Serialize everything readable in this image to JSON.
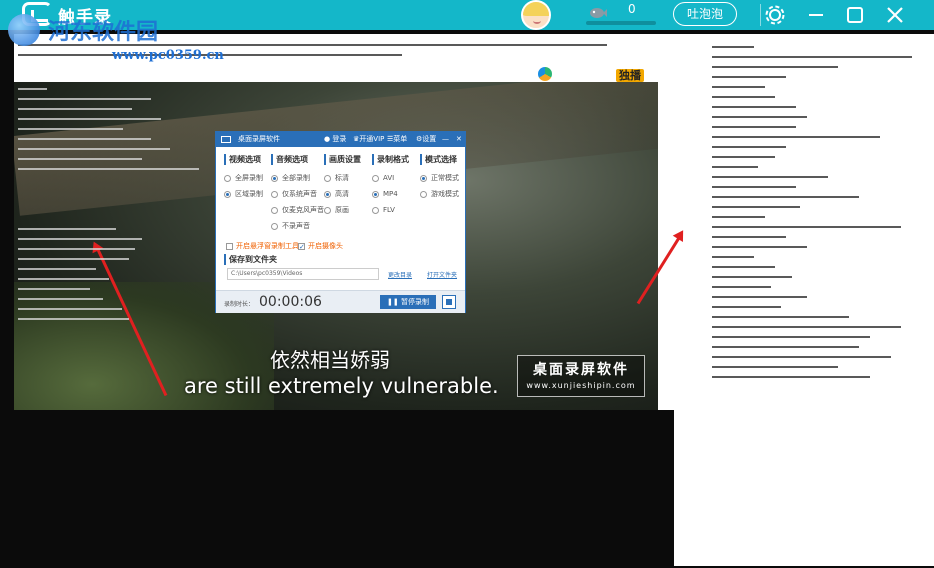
{
  "titlebar": {
    "app_name": "触手录",
    "coin_count": "0",
    "chat_button": "吐泡泡",
    "accent": "#14b7c9"
  },
  "watermark": {
    "site_name": "河东软件园",
    "site_url": "www.pc0359.cn"
  },
  "video": {
    "platform_logo": "腾讯视频",
    "platform_badge": "独播",
    "subtitle_cn": "依然相当娇弱",
    "subtitle_en": "are still extremely vulnerable.",
    "brand_cn": "桌面录屏软件",
    "brand_url": "www.xunjieshipin.com"
  },
  "dialog": {
    "title": "桌面录屏软件",
    "login": "登录",
    "vip": "开通VIP",
    "menu": "菜单",
    "settings": "设置",
    "video_options": {
      "header": "视频选项",
      "options": [
        "全屏录制",
        "区域录制"
      ]
    },
    "audio_options": {
      "header": "音频选项",
      "options": [
        "全部录制",
        "仅系统声音",
        "仅麦克风声音",
        "不录声音"
      ]
    },
    "quality": {
      "header": "画质设置",
      "options": [
        "标清",
        "高清",
        "原画"
      ]
    },
    "format": {
      "header": "录制格式",
      "options": [
        "AVI",
        "MP4",
        "FLV"
      ]
    },
    "mode": {
      "header": "模式选择",
      "options": [
        "正常模式",
        "游戏模式"
      ]
    },
    "checkbox_float": "开启悬浮窗录制工具",
    "checkbox_camera": "开启摄像头",
    "save_header": "保存到文件夹",
    "save_path": "C:\\Users\\pc0359\\Videos",
    "change_dir": "更改目录",
    "open_folder": "打开文件夹",
    "timer_label": "录制时长：",
    "timer": "00:00:06",
    "pause_button": "暂停录制"
  },
  "corner_logo": "触手"
}
